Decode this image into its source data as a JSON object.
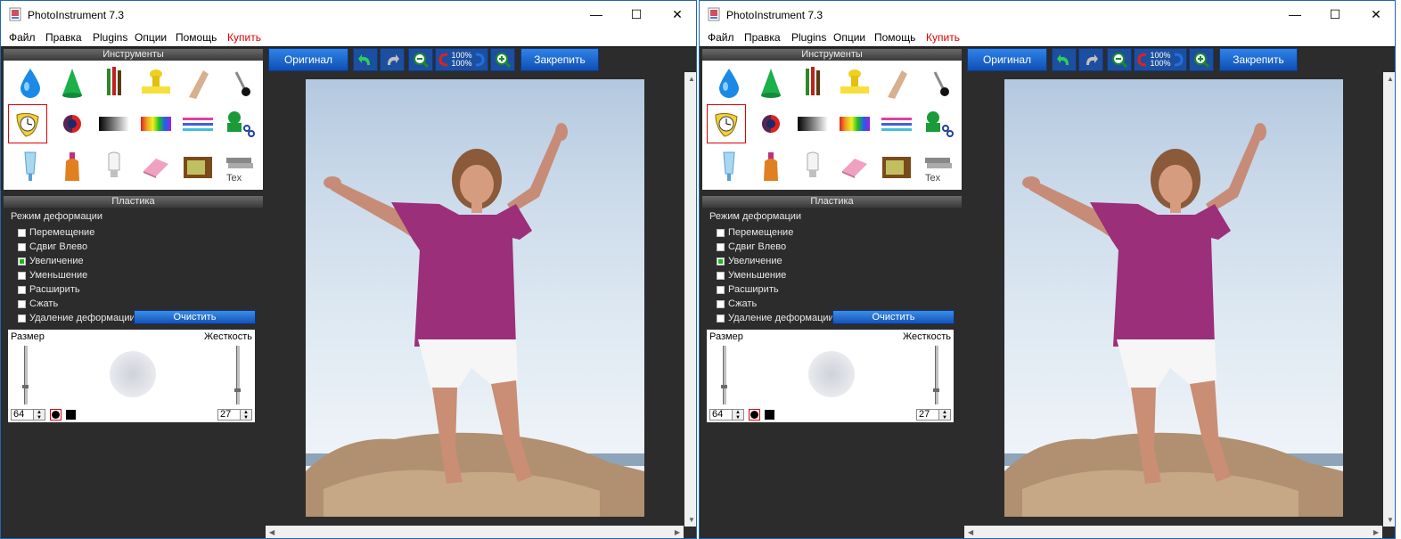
{
  "windows": [
    {
      "title": "PhotoInstrument 7.3",
      "menu": [
        "Файл",
        "Правка",
        "Plugins",
        "Опции",
        "Помощь",
        "Купить"
      ],
      "panels": {
        "tools_title": "Инструменты",
        "plastic_title": "Пластика"
      },
      "deform": {
        "title": "Режим деформации",
        "options": [
          {
            "label": "Перемещение",
            "checked": false
          },
          {
            "label": "Сдвиг Влево",
            "checked": false
          },
          {
            "label": "Увеличение",
            "checked": true
          },
          {
            "label": "Уменьшение",
            "checked": false
          },
          {
            "label": "Расширить",
            "checked": false
          },
          {
            "label": "Сжать",
            "checked": false
          },
          {
            "label": "Удаление деформации",
            "checked": false
          }
        ],
        "clear_label": "Очистить"
      },
      "brush": {
        "size_label": "Размер",
        "hardness_label": "Жесткость",
        "size_value": "64",
        "hardness_value": "27"
      },
      "toolbar": {
        "original_label": "Оригинал",
        "zoom_top": "100%",
        "zoom_bottom": "100%",
        "pin_label": "Закрепить"
      }
    },
    {
      "title": "PhotoInstrument 7.3",
      "menu": [
        "Файл",
        "Правка",
        "Plugins",
        "Опции",
        "Помощь",
        "Купить"
      ],
      "panels": {
        "tools_title": "Инструменты",
        "plastic_title": "Пластика"
      },
      "deform": {
        "title": "Режим деформации",
        "options": [
          {
            "label": "Перемещение",
            "checked": false
          },
          {
            "label": "Сдвиг Влево",
            "checked": false
          },
          {
            "label": "Увеличение",
            "checked": true
          },
          {
            "label": "Уменьшение",
            "checked": false
          },
          {
            "label": "Расширить",
            "checked": false
          },
          {
            "label": "Сжать",
            "checked": false
          },
          {
            "label": "Удаление деформации",
            "checked": false
          }
        ],
        "clear_label": "Очистить"
      },
      "brush": {
        "size_label": "Размер",
        "hardness_label": "Жесткость",
        "size_value": "64",
        "hardness_value": "27"
      },
      "toolbar": {
        "original_label": "Оригинал",
        "zoom_top": "100%",
        "zoom_bottom": "100%",
        "pin_label": "Закрепить"
      }
    }
  ],
  "icons": {
    "tools": [
      "water-drop-icon",
      "cone-icon",
      "brushes-icon",
      "stamp-icon",
      "smudge-finger-icon",
      "clone-pin-icon",
      "plastic-clock-icon",
      "red-eye-icon",
      "gradient-icon",
      "rainbow-icon",
      "color-lines-icon",
      "cut-icon",
      "tube-icon",
      "bottle-icon",
      "light-bulb-icon",
      "eraser-icon",
      "tv-icon",
      "text-icon"
    ],
    "selected_tool": "plastic-clock-icon"
  },
  "colors": {
    "accent_blue": "#1a5cc4",
    "buy_red": "#e00000",
    "selected_red": "#e00000",
    "checked_green": "#18b818"
  }
}
